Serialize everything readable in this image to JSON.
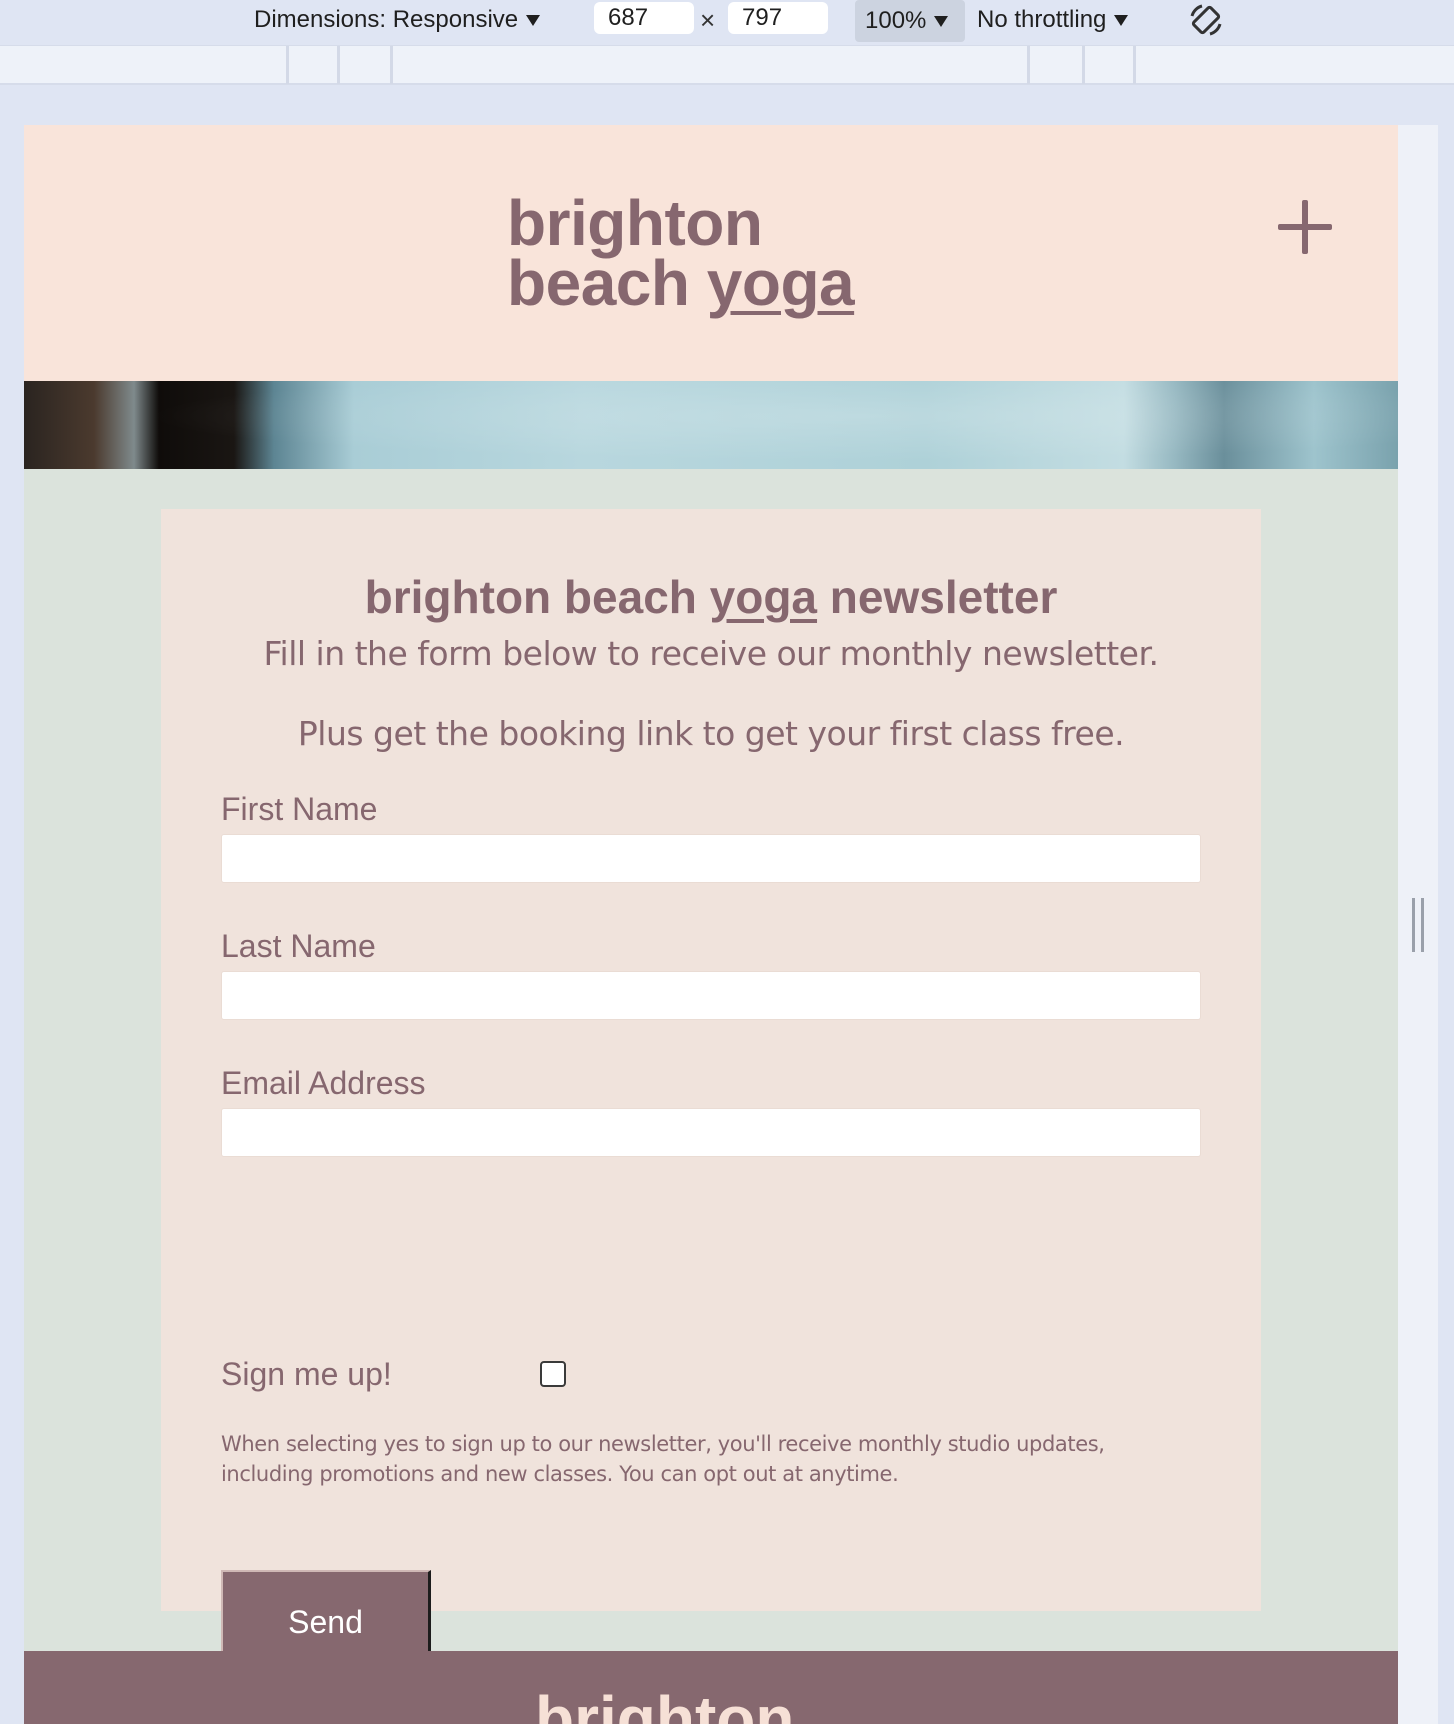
{
  "devtools": {
    "dimensions_label": "Dimensions: Responsive",
    "width_value": "687",
    "times": "×",
    "height_value": "797",
    "zoom": "100%",
    "throttling": "No throttling",
    "rotate_icon": "rotate-icon"
  },
  "site": {
    "logo_line1": "brighton",
    "logo_line2_a": "beach ",
    "logo_line2_b": "yoga",
    "menu_icon": "plus-icon"
  },
  "newsletter": {
    "title_a": "brighton beach ",
    "title_b": "yoga",
    "title_c": " newsletter",
    "subtitle": "Fill in the form below to receive our monthly newsletter.",
    "subtitle2": "Plus get the booking link to get your first class free.",
    "first_name_label": "First Name",
    "first_name_value": "",
    "last_name_label": "Last Name",
    "last_name_value": "",
    "email_label": "Email Address",
    "email_value": "",
    "signup_label": "Sign me up!",
    "signup_checked": false,
    "fine_print": "When selecting yes to sign up to our newsletter, you'll receive monthly studio updates, including promotions and new classes. You can opt out at anytime.",
    "send_label": "Send"
  },
  "footer": {
    "logo_text": "brighton"
  },
  "colors": {
    "brand_mauve": "#86676f",
    "header_bg": "#f9e4da",
    "card_bg": "#f0e3dc",
    "page_bg": "#dbe3dc"
  }
}
